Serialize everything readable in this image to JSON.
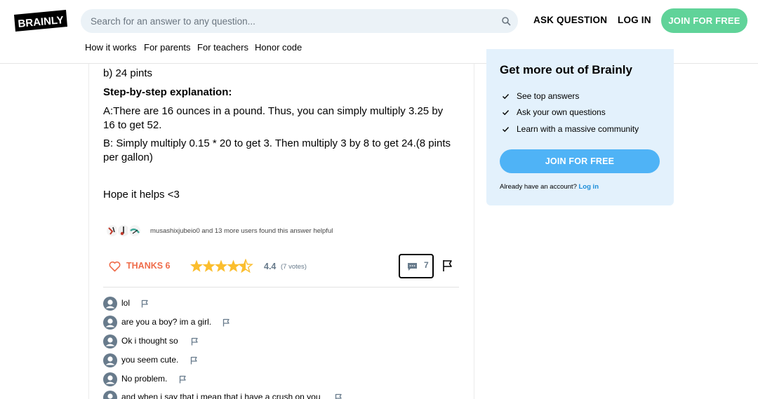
{
  "header": {
    "logo_text": "BRAINLY",
    "search": {
      "placeholder": "Search for an answer to any question..."
    },
    "ask_question": "ASK QUESTION",
    "log_in": "LOG IN",
    "join": "JOIN FOR FREE",
    "subnav": [
      "How it works",
      "For parents",
      "For teachers",
      "Honor code"
    ]
  },
  "answer": {
    "line_b": "b) 24 pints",
    "heading": "Step-by-step explanation:",
    "para_a": "A:There are 16 ounces in a pound. Thus, you can simply multiply 3.25 by 16 to get 52.",
    "para_b": "B: Simply multiply 0.15 * 20 to get 3.  Then multiply 3 by 8 to get 24.(8 pints per gallon)",
    "closing": "Hope it helps <3",
    "helpful_text": "musashixjubeio0 and 13 more users found this answer helpful",
    "thanks_label": "THANKS 6",
    "rating": {
      "value": "4.4",
      "votes": "(7 votes)",
      "stars_filled": 4.4,
      "stars_total": 5
    },
    "comment_count": "7"
  },
  "comments": [
    "lol",
    "are you a boy? im a girl.",
    "Ok i thought so",
    "you seem cute.",
    "No problem.",
    "and when i say that i mean that i have a crush on you"
  ],
  "sidebar": {
    "title": "Get more out of Brainly",
    "features": [
      "See top answers",
      "Ask your own questions",
      "Learn with a massive community"
    ],
    "join": "JOIN FOR FREE",
    "already_text": "Already have an account?",
    "login_link": "Log in"
  },
  "colors": {
    "join_green": "#60d399",
    "join_blue": "#4fb3f6",
    "card_bg": "#e3f1fc",
    "thanks_red": "#ef6c4a",
    "star_yellow": "#fbbe2e"
  }
}
